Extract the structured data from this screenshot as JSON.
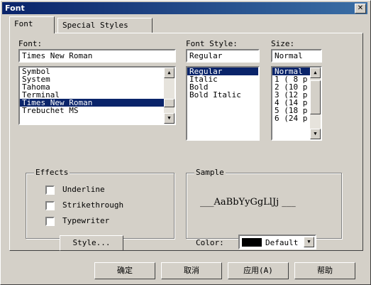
{
  "window": {
    "title": "Font",
    "close_glyph": "✕"
  },
  "tabs": [
    {
      "label": "Font"
    },
    {
      "label": "Special Styles"
    }
  ],
  "font": {
    "label": "Font:",
    "value": "Times New Roman",
    "items": [
      "Symbol",
      "System",
      "Tahoma",
      "Terminal",
      "Times New Roman",
      "Trebuchet MS"
    ],
    "selected_index": 4
  },
  "style": {
    "label": "Font Style:",
    "value": "Regular",
    "items": [
      "Regular",
      "Italic",
      "Bold",
      "Bold Italic"
    ],
    "selected_index": 0
  },
  "size": {
    "label": "Size:",
    "value": "Normal",
    "items": [
      "Normal",
      "1 ( 8 p",
      "2 (10 p",
      "3 (12 p",
      "4 (14 p",
      "5 (18 p",
      "6 (24 p"
    ],
    "selected_index": 0
  },
  "effects": {
    "label": "Effects",
    "items": [
      {
        "label": "Underline",
        "checked": false
      },
      {
        "label": "Strikethrough",
        "checked": false
      },
      {
        "label": "Typewriter",
        "checked": false
      }
    ]
  },
  "sample": {
    "label": "Sample",
    "text": "___AaBbYyGgLlJj ___"
  },
  "style_button": "Style...",
  "color": {
    "label": "Color:",
    "value": "Default",
    "swatch": "#000000"
  },
  "footer": {
    "ok": "确定",
    "cancel": "取消",
    "apply": "应用(A)",
    "help": "帮助"
  },
  "icons": {
    "up": "▲",
    "down": "▼"
  }
}
